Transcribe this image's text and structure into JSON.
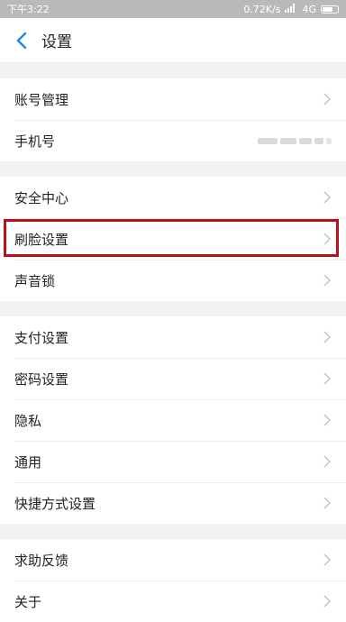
{
  "status_bar": {
    "time": "下午3:22",
    "network": "0.72K/s",
    "signal": "4G"
  },
  "nav": {
    "title": "设置",
    "back_icon": "chevron-left-icon"
  },
  "groups": [
    [
      {
        "label": "账号管理",
        "value": "",
        "has_chevron": true
      },
      {
        "label": "手机号",
        "value": "",
        "has_chevron": false,
        "value_redacted": true
      }
    ],
    [
      {
        "label": "安全中心",
        "has_chevron": true
      },
      {
        "label": "刷脸设置",
        "has_chevron": true,
        "highlighted": true
      },
      {
        "label": "声音锁",
        "has_chevron": true
      }
    ],
    [
      {
        "label": "支付设置",
        "has_chevron": true
      },
      {
        "label": "密码设置",
        "has_chevron": true
      },
      {
        "label": "隐私",
        "has_chevron": true
      },
      {
        "label": "通用",
        "has_chevron": true
      },
      {
        "label": "快捷方式设置",
        "has_chevron": true
      }
    ],
    [
      {
        "label": "求助反馈",
        "has_chevron": true
      },
      {
        "label": "关于",
        "has_chevron": true
      }
    ]
  ],
  "colors": {
    "accent": "#1e88e5",
    "highlight": "#b8101a",
    "background": "#f2f2f2"
  }
}
